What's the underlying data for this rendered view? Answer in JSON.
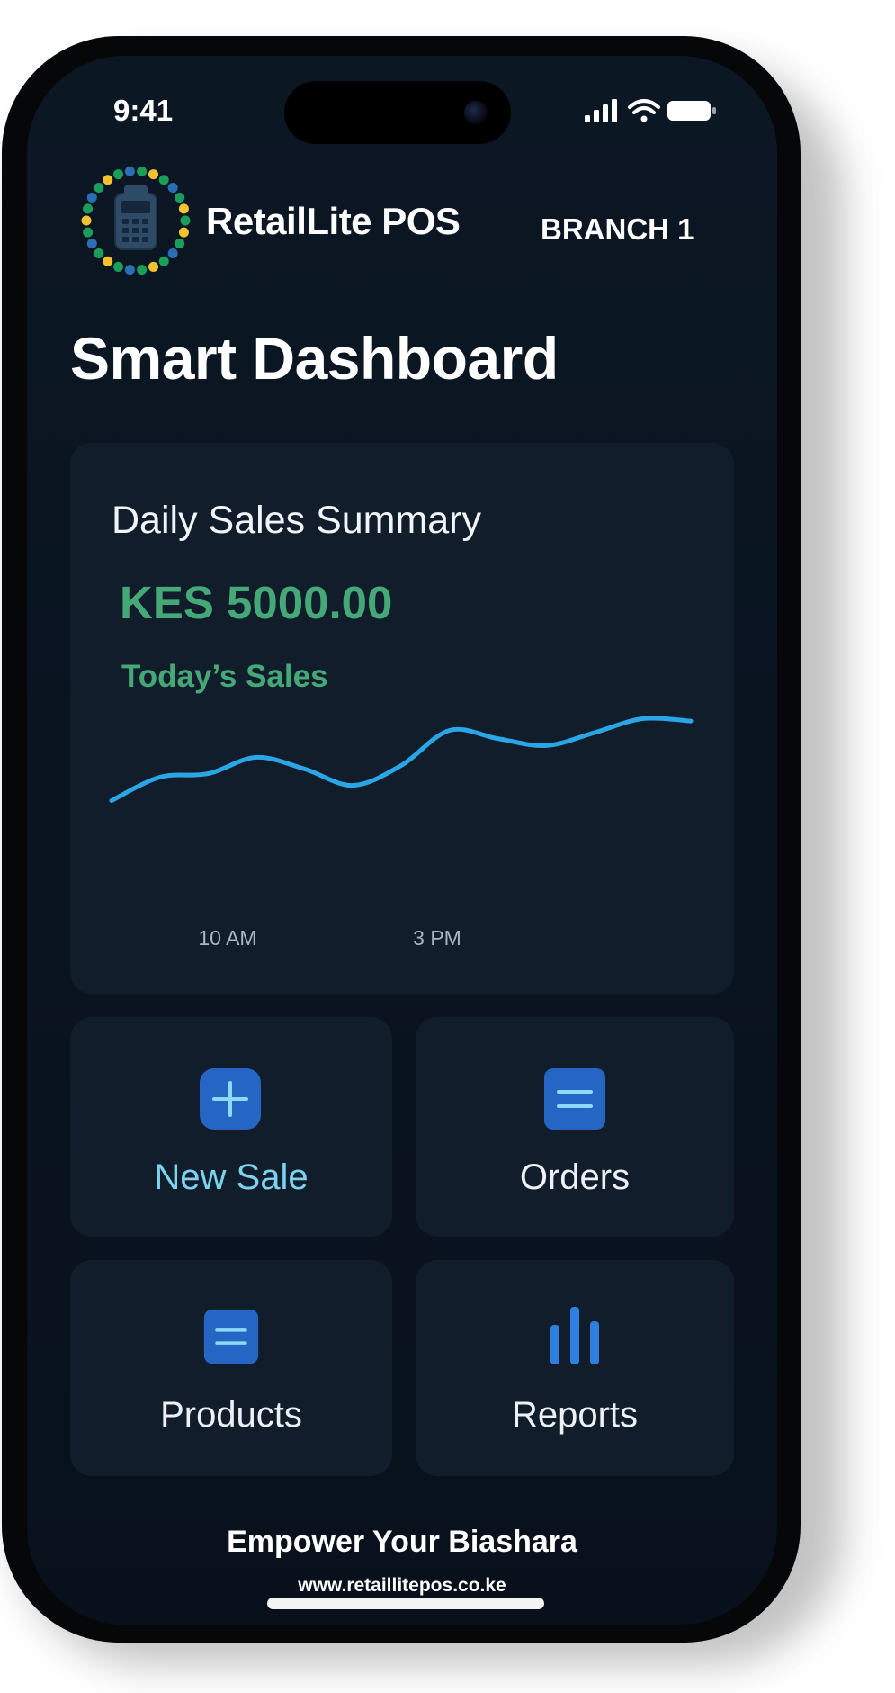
{
  "status_bar": {
    "time": "9:41"
  },
  "header": {
    "brand": "RetailLite POS",
    "branch": "BRANCH 1"
  },
  "page_title": "Smart Dashboard",
  "summary": {
    "title": "Daily Sales Summary",
    "amount": "KES 5000.00",
    "label": "Today’s Sales"
  },
  "chart_data": {
    "type": "line",
    "x_ticks": [
      "10 AM",
      "3 PM"
    ],
    "series": [
      {
        "values": [
          0.25,
          0.45,
          0.48,
          0.62,
          0.52,
          0.38,
          0.55,
          0.85,
          0.78,
          0.72,
          0.83,
          0.95,
          0.93
        ]
      }
    ],
    "ylim": [
      0,
      1
    ],
    "grid": false,
    "color": "#2aa6e6"
  },
  "tiles": [
    {
      "label": "New Sale",
      "icon": "plus-icon",
      "color": "#7cd3ef"
    },
    {
      "label": "Orders",
      "icon": "list-icon",
      "color": "#ecf1f6"
    },
    {
      "label": "Products",
      "icon": "list-icon",
      "color": "#ecf1f6"
    },
    {
      "label": "Reports",
      "icon": "bar-chart-icon",
      "color": "#ecf1f6"
    }
  ],
  "footer": {
    "slogan": "Empower Your Biashara",
    "url": "www.retaillitepos.co.ke"
  },
  "colors": {
    "accent_green": "#45a877",
    "accent_blue": "#2aa6e6",
    "icon_blue": "#2566c5",
    "card_bg": "#111d2b"
  }
}
